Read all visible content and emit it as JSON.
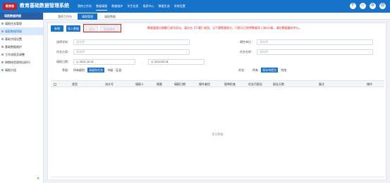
{
  "header": {
    "logo_text": "教育局",
    "title": "教育基础数据管理系统",
    "nav": [
      "我的工作台",
      "数据填报",
      "数据维护",
      "学生信息",
      "报表中心",
      "数据生成",
      "系统设置"
    ],
    "active_nav": 1,
    "icons": [
      "help-icon",
      "user-icon",
      "settings-icon",
      "power-icon"
    ],
    "icon_glyphs": [
      "?",
      "☺",
      "⚙",
      "⏻"
    ]
  },
  "sidebar": {
    "title": "填报数据明细",
    "items": [
      "填报任务管理",
      "填报数据明细",
      "基础字段设置",
      "基础数据维护",
      "工作流程及调整",
      "跨期校验规则自检行",
      "填报分组"
    ],
    "active": 1,
    "collapse_glyph": "«"
  },
  "tabs": {
    "items": [
      "我的工作台",
      "填报管理",
      "填报数据"
    ],
    "active": 1
  },
  "toolbar": {
    "buttons": [
      "新增",
      "导入数据",
      "导出",
      "批量删除"
    ],
    "notice": "数据量超出限额已成功导出，请点击【下载】按钮，当下载数量较大，只提示已经将数据导入到200条，请在数据备份中心。"
  },
  "form": {
    "school_label": "选择学校：",
    "school_placeholder": "请选择",
    "unit_label": "属性单位：",
    "unit_placeholder": "请选择",
    "type_label": "任务分类：",
    "type_placeholder": "请选择",
    "task_label": "任务名称：",
    "task_placeholder": "请选择",
    "date_label": "填报日期：",
    "date_start": "2021.10.01",
    "date_sep": "-",
    "date_end": "2022.03.31",
    "level_label": "等级：",
    "level_options": [
      "所有级别",
      "高级别任务",
      "市级",
      "区县"
    ],
    "level_selected": 1,
    "status_label": "状态：",
    "status_options": [
      "所有",
      "保存待提交",
      "完成"
    ],
    "status_selected": 1
  },
  "table": {
    "columns": [
      "类型",
      "流水号",
      "填报人",
      "摘要",
      "填报日期",
      "操作者信",
      "报审检查",
      "任务月报告",
      "报告天数",
      "备注",
      "操作"
    ],
    "empty_text": "暂无数据"
  }
}
